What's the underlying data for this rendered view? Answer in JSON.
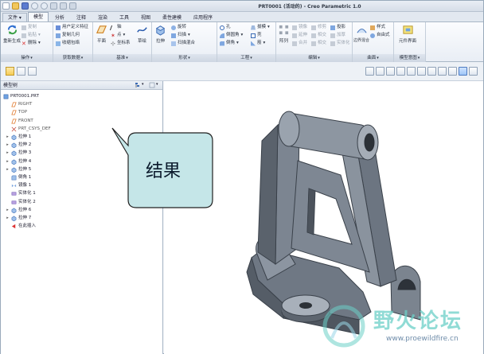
{
  "window": {
    "title": "PRT0001 (活动的) - Creo Parametric 1.0"
  },
  "tabs": [
    {
      "label": "文件",
      "has_dropdown": true
    },
    {
      "label": "模型",
      "active": true
    },
    {
      "label": "分析"
    },
    {
      "label": "注释"
    },
    {
      "label": "渲染"
    },
    {
      "label": "工具"
    },
    {
      "label": "视图"
    },
    {
      "label": "柔性建模"
    },
    {
      "label": "应用程序"
    }
  ],
  "ribbon": {
    "groups": [
      {
        "caption": "操作",
        "items": [
          "重新生成",
          "复制",
          "粘贴",
          "删除"
        ]
      },
      {
        "caption": "获取数据",
        "items": [
          "用户定义特征",
          "复制几何",
          "收缩包络"
        ]
      },
      {
        "caption": "基准",
        "items": [
          "平面",
          "轴",
          "点",
          "坐标系",
          "草绘"
        ]
      },
      {
        "caption": "形状",
        "items": [
          "拉伸",
          "旋转",
          "扫描",
          "扫描混合"
        ]
      },
      {
        "caption": "工程",
        "items": [
          "孔",
          "倒圆角",
          "倒角",
          "拔模",
          "壳",
          "筋"
        ]
      },
      {
        "caption": "编辑",
        "items": [
          "阵列",
          "镜像",
          "延伸",
          "修剪",
          "投影",
          "加厚",
          "合并",
          "相交",
          "实体化"
        ]
      },
      {
        "caption": "曲面",
        "items": [
          "边界混合",
          "样式",
          "造型",
          "自由式"
        ]
      },
      {
        "caption": "模型意图",
        "items": [
          "元件界面"
        ]
      }
    ]
  },
  "model_tree": {
    "title": "模型树",
    "items": [
      {
        "label": "PRT0001.PRT",
        "icon": "part-icon",
        "level": 0
      },
      {
        "label": "RIGHT",
        "icon": "datum-plane-icon",
        "level": 1
      },
      {
        "label": "TOP",
        "icon": "datum-plane-icon",
        "level": 1
      },
      {
        "label": "FRONT",
        "icon": "datum-plane-icon",
        "level": 1
      },
      {
        "label": "PRT_CSYS_DEF",
        "icon": "csys-icon",
        "level": 1
      },
      {
        "label": "拉伸 1",
        "icon": "extrude-icon",
        "level": 1,
        "expandable": true
      },
      {
        "label": "拉伸 2",
        "icon": "extrude-icon",
        "level": 1,
        "expandable": true
      },
      {
        "label": "拉伸 3",
        "icon": "extrude-icon",
        "level": 1,
        "expandable": true
      },
      {
        "label": "拉伸 4",
        "icon": "extrude-icon",
        "level": 1,
        "expandable": true
      },
      {
        "label": "拉伸 5",
        "icon": "extrude-icon",
        "level": 1,
        "expandable": true
      },
      {
        "label": "倒角 1",
        "icon": "chamfer-icon",
        "level": 1
      },
      {
        "label": "镜像 1",
        "icon": "mirror-icon",
        "level": 1
      },
      {
        "label": "实体化 1",
        "icon": "solidify-icon",
        "level": 1
      },
      {
        "label": "实体化 2",
        "icon": "solidify-icon",
        "level": 1
      },
      {
        "label": "拉伸 6",
        "icon": "extrude-icon",
        "level": 1,
        "expandable": true
      },
      {
        "label": "拉伸 7",
        "icon": "extrude-icon",
        "level": 1,
        "expandable": true
      },
      {
        "label": "在此插入",
        "icon": "insert-here-icon",
        "level": 1
      }
    ]
  },
  "callout": {
    "text": "结果"
  },
  "watermark": {
    "text": "野火论坛",
    "url": "www.proewildfire.cn"
  },
  "colors": {
    "accent": "#4d7ac0",
    "model_fill": "#808a96",
    "callout_fill": "#c5e6e8",
    "datum_plane": "#e07a2e"
  }
}
